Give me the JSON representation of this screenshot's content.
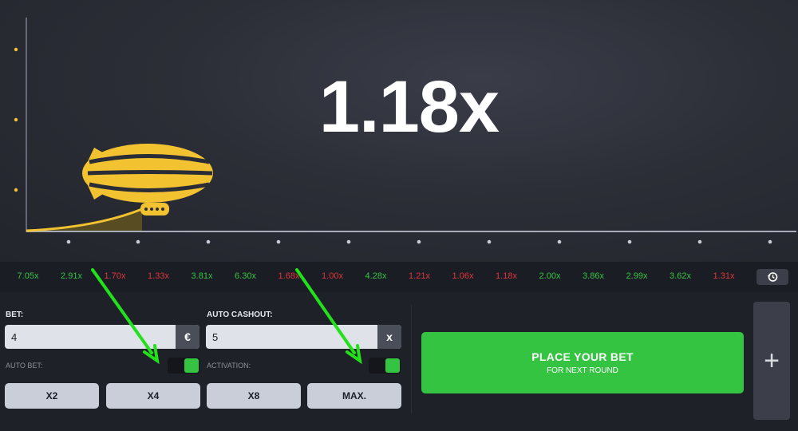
{
  "game": {
    "multiplier": "1.18x"
  },
  "history": {
    "items": [
      {
        "value": "7.05x",
        "status": "win"
      },
      {
        "value": "2.91x",
        "status": "win"
      },
      {
        "value": "1.70x",
        "status": "loss"
      },
      {
        "value": "1.33x",
        "status": "loss"
      },
      {
        "value": "3.81x",
        "status": "win"
      },
      {
        "value": "6.30x",
        "status": "win"
      },
      {
        "value": "1.68x",
        "status": "loss"
      },
      {
        "value": "1.00x",
        "status": "loss"
      },
      {
        "value": "4.28x",
        "status": "win"
      },
      {
        "value": "1.21x",
        "status": "loss"
      },
      {
        "value": "1.06x",
        "status": "loss"
      },
      {
        "value": "1.18x",
        "status": "loss"
      },
      {
        "value": "2.00x",
        "status": "win"
      },
      {
        "value": "3.86x",
        "status": "win"
      },
      {
        "value": "2.99x",
        "status": "win"
      },
      {
        "value": "3.62x",
        "status": "win"
      },
      {
        "value": "1.31x",
        "status": "loss"
      }
    ],
    "history_icon": "history-icon"
  },
  "bet": {
    "label": "BET:",
    "value": "4",
    "currency": "€",
    "auto_bet_label": "AUTO BET:",
    "auto_bet_on": true
  },
  "auto_cashout": {
    "label": "AUTO CASHOUT:",
    "value": "5",
    "clear": "x",
    "activation_label": "ACTIVATION:",
    "activation_on": true
  },
  "quick_buttons": [
    "X2",
    "X4",
    "X8",
    "MAX."
  ],
  "place_bet": {
    "title": "PLACE YOUR BET",
    "subtitle": "FOR NEXT ROUND"
  },
  "add_panel": {
    "label": "+"
  },
  "colors": {
    "accent_green": "#35c442",
    "loss_red": "#e0363b",
    "zeppelin_yellow": "#f2c230",
    "arrow_green": "#22e01a"
  }
}
